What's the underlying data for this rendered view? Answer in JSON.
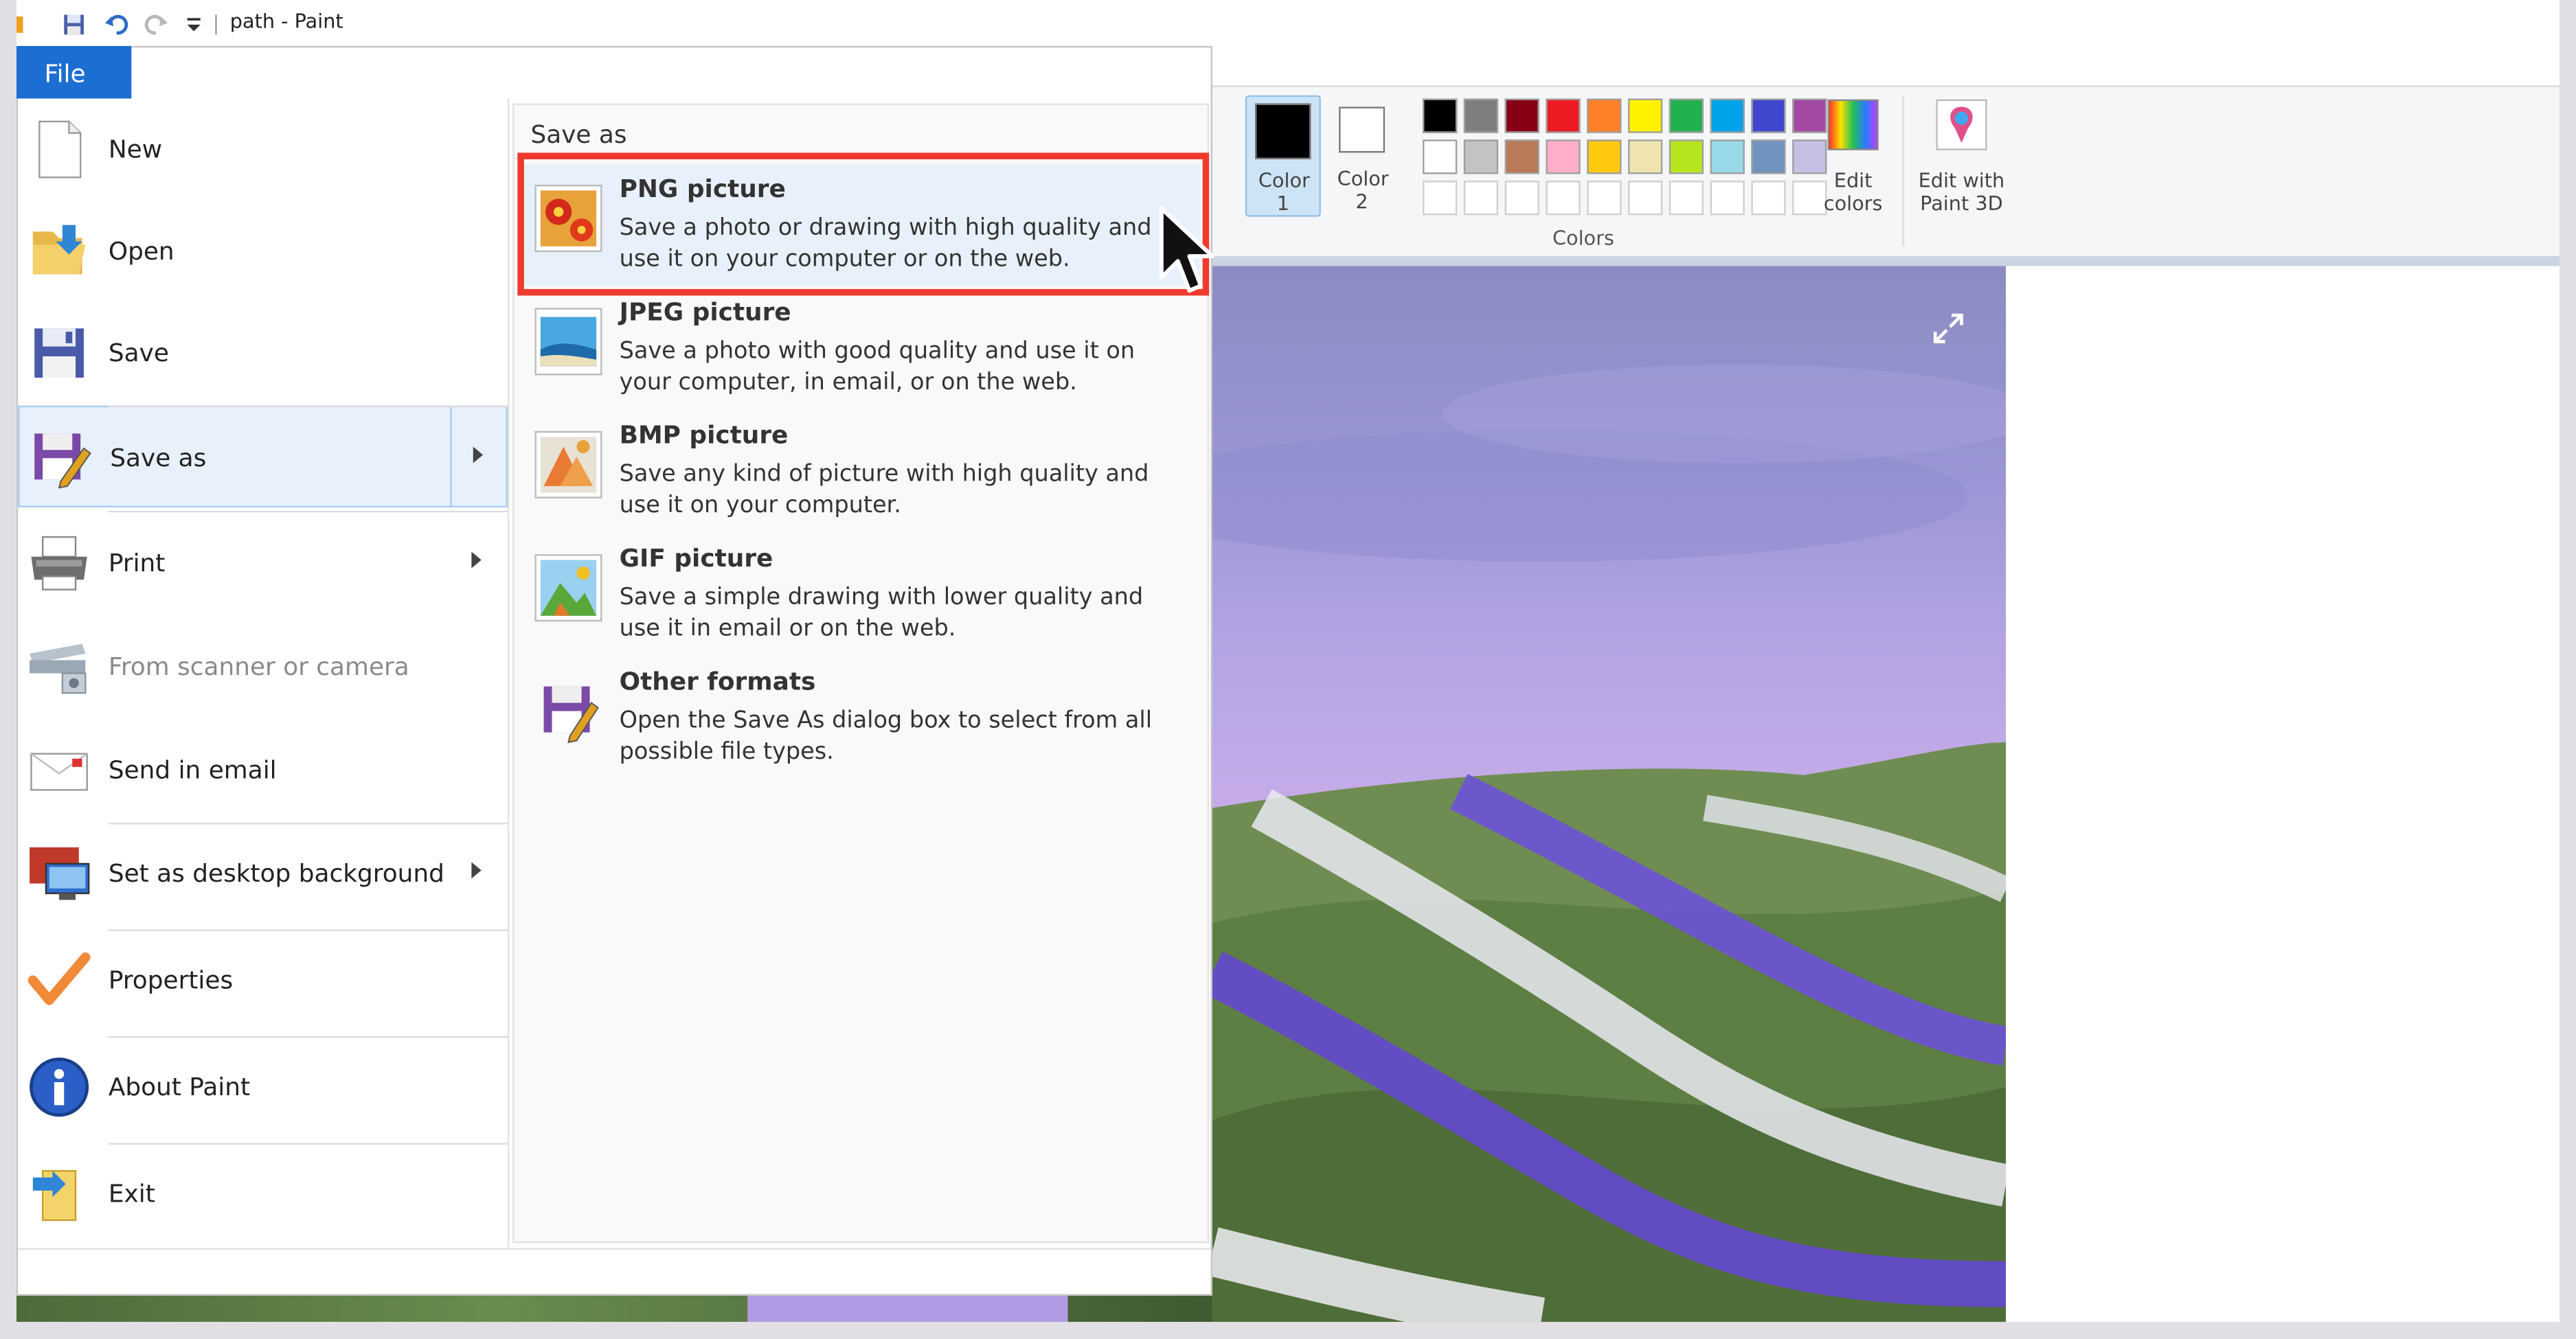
{
  "window": {
    "title": "path - Paint"
  },
  "file_tab": {
    "label": "File"
  },
  "file_menu": [
    {
      "label": "New",
      "icon": "new-file-icon",
      "has_arrow": false
    },
    {
      "label": "Open",
      "icon": "open-folder-icon",
      "has_arrow": false
    },
    {
      "label": "Save",
      "icon": "floppy-disk-icon",
      "has_arrow": false
    },
    {
      "label": "Save as",
      "icon": "save-as-icon",
      "has_arrow": true,
      "highlighted": true
    },
    {
      "label": "Print",
      "icon": "printer-icon",
      "has_arrow": true
    },
    {
      "label": "From scanner or camera",
      "icon": "scanner-icon",
      "has_arrow": false,
      "disabled": true
    },
    {
      "label": "Send in email",
      "icon": "email-icon",
      "has_arrow": false
    },
    {
      "label": "Set as desktop background",
      "icon": "desktop-icon",
      "has_arrow": true
    },
    {
      "label": "Properties",
      "icon": "checkmark-icon",
      "has_arrow": false
    },
    {
      "label": "About Paint",
      "icon": "info-icon",
      "has_arrow": false
    },
    {
      "label": "Exit",
      "icon": "exit-icon",
      "has_arrow": false
    }
  ],
  "save_as_panel": {
    "title": "Save as",
    "options": [
      {
        "name": "PNG picture",
        "description": "Save a photo or drawing with high quality and use it on your computer or on the web.",
        "icon": "png-picture-icon",
        "highlighted": true
      },
      {
        "name": "JPEG picture",
        "description": "Save a photo with good quality and use it on your computer, in email, or on the web.",
        "icon": "jpeg-picture-icon"
      },
      {
        "name": "BMP picture",
        "description": "Save any kind of picture with high quality and use it on your computer.",
        "icon": "bmp-picture-icon"
      },
      {
        "name": "GIF picture",
        "description": "Save a simple drawing with lower quality and use it in email or on the web.",
        "icon": "gif-picture-icon"
      },
      {
        "name": "Other formats",
        "description": "Open the Save As dialog box to select from all possible file types.",
        "icon": "other-formats-icon"
      }
    ]
  },
  "ribbon": {
    "color1": {
      "label": "Color 1",
      "color": "#000000"
    },
    "color2": {
      "label": "Color 2",
      "color": "#ffffff"
    },
    "colors_group_label": "Colors",
    "edit_colors_label": "Edit colors",
    "edit_paint3d_label": "Edit with Paint 3D",
    "palette_row1": [
      "#000000",
      "#7f7f7f",
      "#880015",
      "#ed1c24",
      "#ff7f27",
      "#fff200",
      "#22b14c",
      "#00a2e8",
      "#3f48cc",
      "#a349a4"
    ],
    "palette_row2": [
      "#ffffff",
      "#c3c3c3",
      "#b97a57",
      "#ffaec9",
      "#ffc90e",
      "#efe4b0",
      "#b5e61d",
      "#99d9ea",
      "#7092be",
      "#c8bfe7"
    ]
  }
}
